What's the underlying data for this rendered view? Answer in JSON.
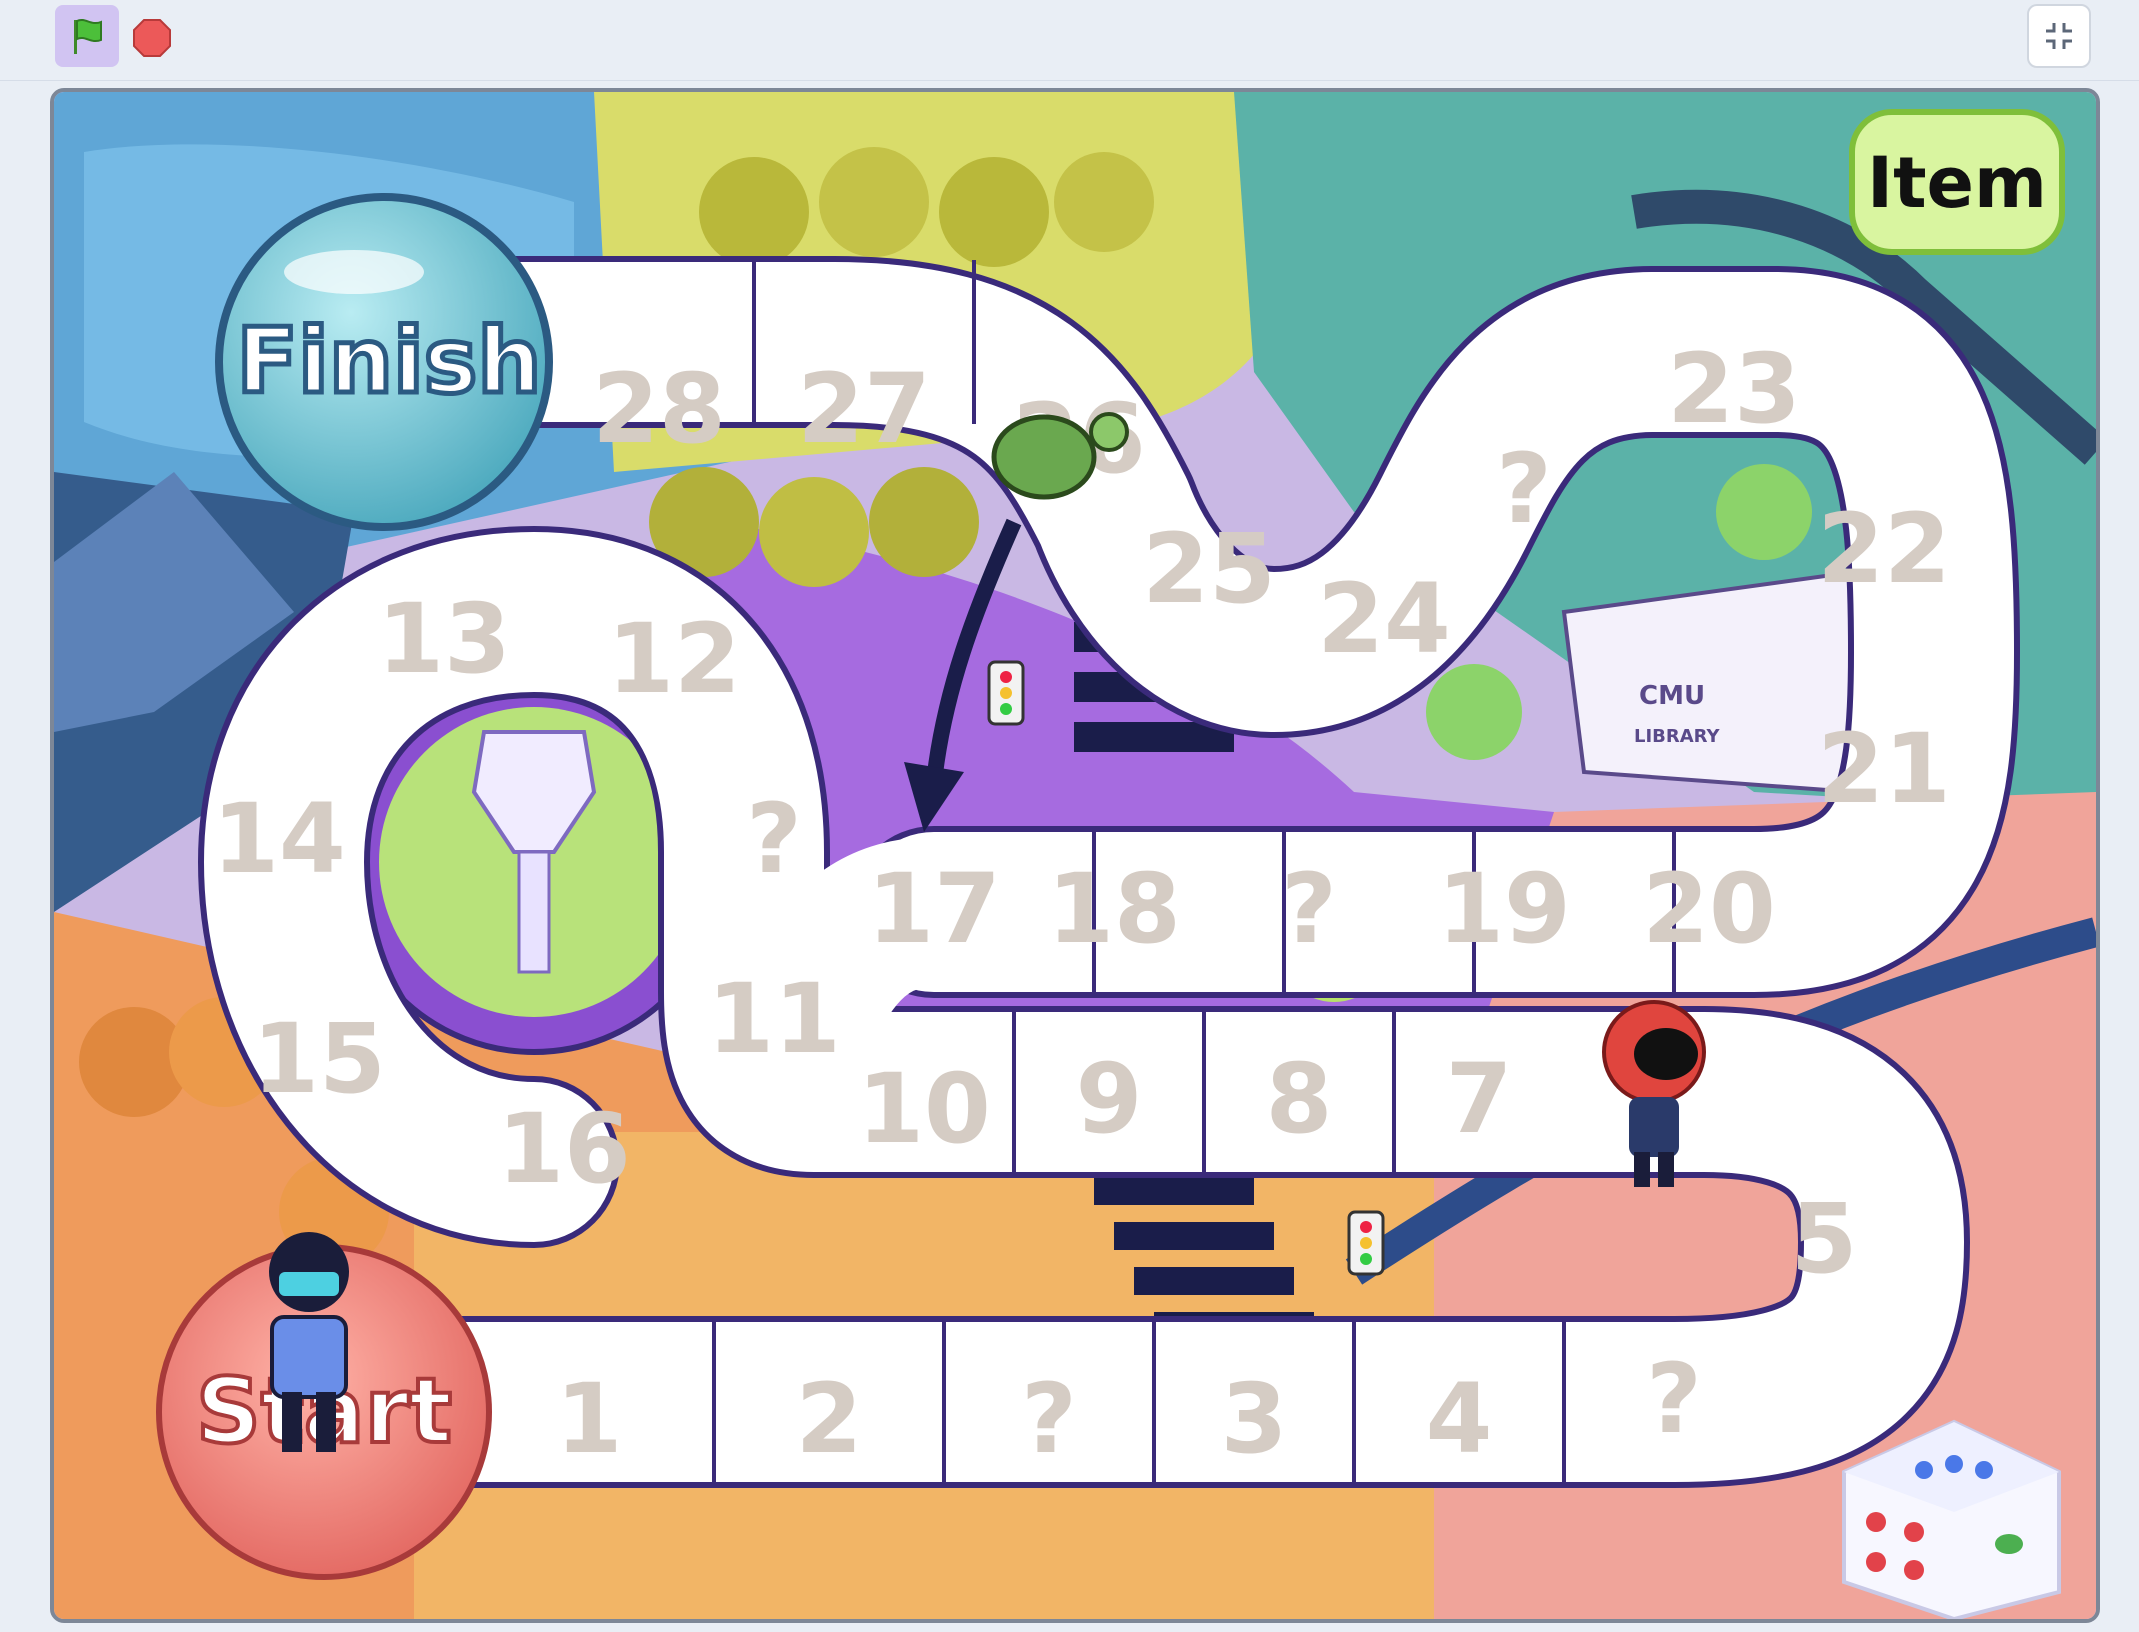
{
  "toolbar": {
    "green_flag_icon": "green-flag-icon",
    "stop_icon": "stop-sign-icon",
    "fullscreen_icon": "exit-fullscreen-icon"
  },
  "board": {
    "finish_label": "Finish",
    "start_label": "Start",
    "item_button_label": "Item",
    "library_sign": "CMU",
    "library_subsign": "LIBRARY",
    "squares": [
      "1",
      "2",
      "?",
      "3",
      "4",
      "?",
      "5",
      "7",
      "8",
      "9",
      "10",
      "11",
      "?",
      "12",
      "13",
      "14",
      "15",
      "16",
      "17",
      "18",
      "?",
      "19",
      "20",
      "21",
      "22",
      "23",
      "?",
      "24",
      "25",
      "26",
      "27",
      "28"
    ]
  },
  "colors": {
    "path_fill": "#ffffff",
    "path_outline": "#3a2a7a",
    "number_color": "#d5ccc4",
    "item_button_bg": "#d9f5a0"
  }
}
